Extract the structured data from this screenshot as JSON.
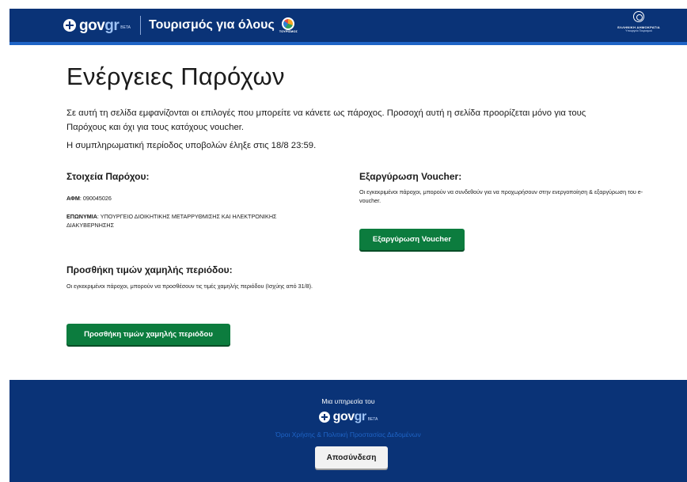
{
  "header": {
    "brand_word": "gov",
    "brand_suffix": "gr",
    "brand_beta": "beta",
    "site_title": "Τουρισμός για όλους",
    "tourism_logo_text": "ΤΟΥΡΙΣΜΟΣ",
    "ministry_line1": "ΕΛΛΗΝΙΚΗ ΔΗΜΟΚΡΑΤΙΑ",
    "ministry_line2": "Υπουργείο Τουρισμού"
  },
  "main": {
    "title": "Ενέργειες Παρόχων",
    "intro": "Σε αυτή τη σελίδα εμφανίζονται οι επιλογές που μπορείτε να κάνετε ως πάροχος. Προσοχή αυτή η σελίδα προορίζεται μόνο για τους Παρόχους και όχι για τους κατόχους voucher.",
    "deadline": "Η συμπληρωματική περίοδος υποβολών έληξε στις 18/8 23:59.",
    "provider": {
      "heading": "Στοιχεία Παρόχου:",
      "afm_label": "ΑΦΜ",
      "afm_value": ": 090045026",
      "name_label": "ΕΠΩΝΥΜΙΑ",
      "name_value": ": ΥΠΟΥΡΓΕΙΟ ΔΙΟΙΚΗΤΙΚΗΣ ΜΕΤΑΡΡΥΘΜΙΣΗΣ ΚΑΙ ΗΛΕΚΤΡΟΝΙΚΗΣ ΔΙΑΚΥΒΕΡΝΗΣΗΣ"
    },
    "voucher": {
      "heading": "Εξαργύρωση Voucher:",
      "description": "Οι εγκεκριμένοι πάροχοι, μπορούν να συνδεθούν για να προχωρήσουν στην ενεργοποίηση & εξαργύρωση του e-voucher.",
      "button": "Εξαργύρωση Voucher"
    },
    "low_season": {
      "heading": "Προσθήκη τιμών χαμηλής περιόδου:",
      "description": "Οι εγκεκριμένοι πάροχοι, μπορούν να προσθέσουν τις τιμές χαμηλής περιόδου (Ισχύης από 31/8).",
      "button": "Προσθήκη τιμών χαμηλής περιόδου"
    }
  },
  "footer": {
    "service_of": "Μια υπηρεσία του",
    "links": "Όροι Χρήσης & Πολιτική Προστασίας Δεδομένων",
    "logout": "Αποσύνδεση"
  },
  "colors": {
    "header_bg": "#0a3377",
    "accent": "#1f64c6",
    "primary_button": "#0c7c3e"
  }
}
